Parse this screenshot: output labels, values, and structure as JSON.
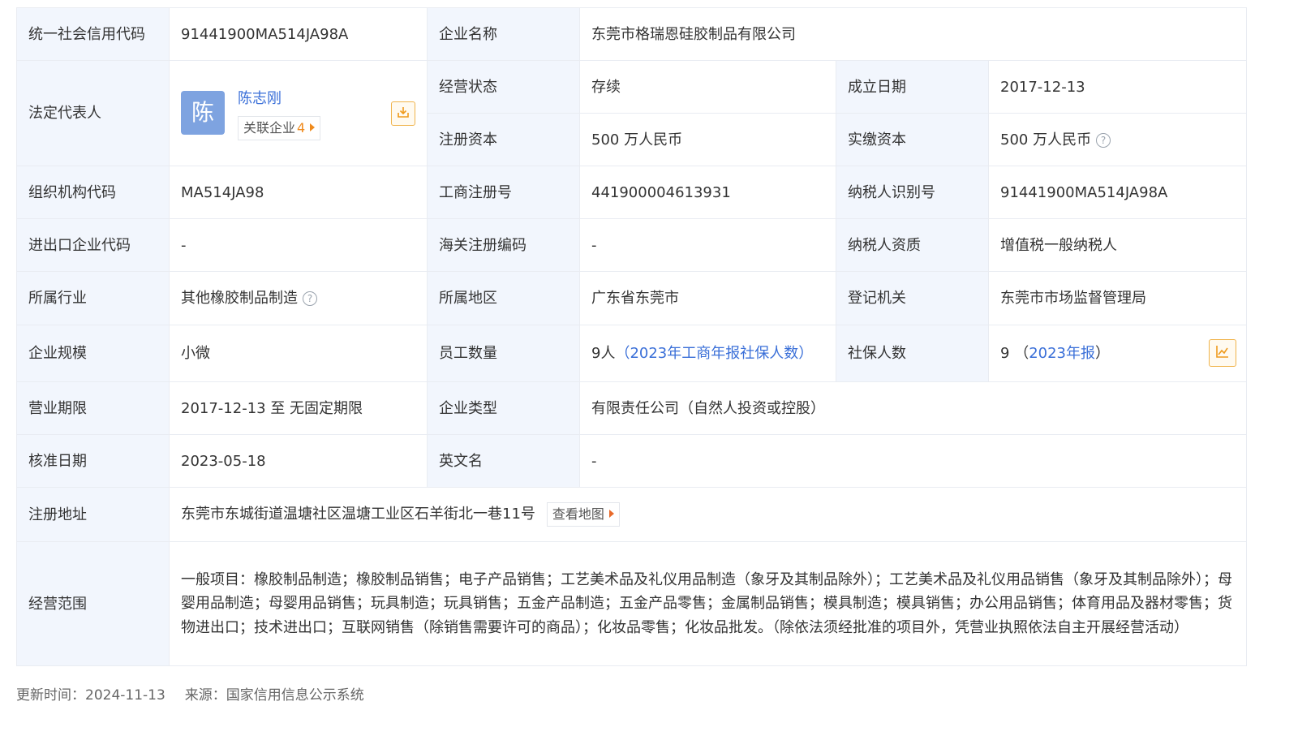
{
  "rows": {
    "r1": {
      "credit_code_label": "统一社会信用代码",
      "credit_code_value": "91441900MA514JA98A",
      "company_name_label": "企业名称",
      "company_name_value": "东莞市格瑞恩硅胶制品有限公司"
    },
    "r2": {
      "legal_rep_label": "法定代表人",
      "avatar_char": "陈",
      "legal_rep_name": "陈志刚",
      "related_label": "关联企业",
      "related_count": "4",
      "status_label": "经营状态",
      "status_value": "存续",
      "founded_label": "成立日期",
      "founded_value": "2017-12-13",
      "reg_capital_label": "注册资本",
      "reg_capital_value": "500 万人民币",
      "paid_capital_label": "实缴资本",
      "paid_capital_value": "500 万人民币"
    },
    "r3": {
      "org_code_label": "组织机构代码",
      "org_code_value": "MA514JA98",
      "biz_reg_label": "工商注册号",
      "biz_reg_value": "441900004613931",
      "taxpayer_id_label": "纳税人识别号",
      "taxpayer_id_value": "91441900MA514JA98A"
    },
    "r4": {
      "import_export_label": "进出口企业代码",
      "import_export_value": "-",
      "customs_label": "海关注册编码",
      "customs_value": "-",
      "taxpayer_type_label": "纳税人资质",
      "taxpayer_type_value": "增值税一般纳税人"
    },
    "r5": {
      "industry_label": "所属行业",
      "industry_value": "其他橡胶制品制造",
      "region_label": "所属地区",
      "region_value": "广东省东莞市",
      "authority_label": "登记机关",
      "authority_value": "东莞市市场监督管理局"
    },
    "r6": {
      "scale_label": "企业规模",
      "scale_value": "小微",
      "employees_label": "员工数量",
      "employees_value": "9人",
      "employees_note": "（2023年工商年报社保人数）",
      "insured_label": "社保人数",
      "insured_value": "9",
      "insured_open": "（",
      "insured_link": "2023年报",
      "insured_close": "）"
    },
    "r7": {
      "term_label": "营业期限",
      "term_value": "2017-12-13 至 无固定期限",
      "type_label": "企业类型",
      "type_value": "有限责任公司（自然人投资或控股）"
    },
    "r8": {
      "approval_label": "核准日期",
      "approval_value": "2023-05-18",
      "english_label": "英文名",
      "english_value": "-"
    },
    "r9": {
      "address_label": "注册地址",
      "address_value": "东莞市东城街道温塘社区温塘工业区石羊街北一巷11号",
      "map_button": "查看地图"
    },
    "r10": {
      "scope_label": "经营范围",
      "scope_value": "一般项目：橡胶制品制造；橡胶制品销售；电子产品销售；工艺美术品及礼仪用品制造（象牙及其制品除外）；工艺美术品及礼仪用品销售（象牙及其制品除外）；母婴用品制造；母婴用品销售；玩具制造；玩具销售；五金产品制造；五金产品零售；金属制品销售；模具制造；模具销售；办公用品销售；体育用品及器材零售；货物进出口；技术进出口；互联网销售（除销售需要许可的商品）；化妆品零售；化妆品批发。（除依法须经批准的项目外，凭营业执照依法自主开展经营活动）"
    }
  },
  "footer": {
    "updated": "更新时间：2024-11-13",
    "source": "来源：国家信用信息公示系统"
  },
  "icons": {
    "question": "question-circle-icon",
    "download": "download-icon",
    "chart": "line-chart-icon",
    "arrow": "caret-right-icon"
  },
  "colors": {
    "label_bg": "#f2f6fd",
    "border": "#e9ecf2",
    "link": "#3a6fd8",
    "accent_orange": "#ef8a1c",
    "avatar": "#7ea3e0"
  }
}
